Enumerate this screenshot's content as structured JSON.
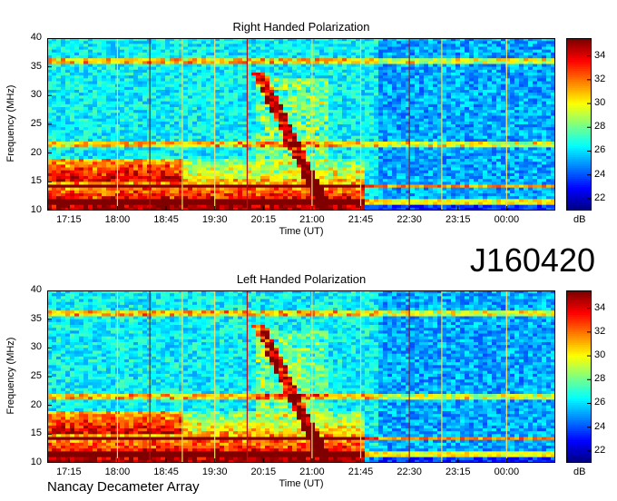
{
  "observatory": "Nancay Decameter Array",
  "code": "J160420",
  "chart_data": [
    {
      "type": "heatmap",
      "title": "Right Handed Polarization",
      "xlabel": "Time (UT)",
      "ylabel": "Frequency (MHz)",
      "x_ticks": [
        "17:15",
        "18:00",
        "18:45",
        "19:30",
        "20:15",
        "21:00",
        "21:45",
        "22:30",
        "23:15",
        "00:00"
      ],
      "y_ticks": [
        10,
        15,
        20,
        25,
        30,
        35,
        40
      ],
      "ylim": [
        10,
        40
      ],
      "xlim": [
        "16:55",
        "00:45"
      ],
      "colorbar": {
        "unit": "dB",
        "range": [
          21,
          35.5
        ],
        "ticks": [
          22,
          24,
          26,
          28,
          30,
          32,
          34
        ]
      },
      "vertical_markers": [
        "18:00",
        "18:30",
        "19:00",
        "19:30",
        "20:00",
        "21:00",
        "21:45",
        "22:30",
        "23:00",
        "00:00"
      ]
    },
    {
      "type": "heatmap",
      "title": "Left Handed Polarization",
      "xlabel": "Time (UT)",
      "ylabel": "Frequency (MHz)",
      "x_ticks": [
        "17:15",
        "18:00",
        "18:45",
        "19:30",
        "20:15",
        "21:00",
        "21:45",
        "22:30",
        "23:15",
        "00:00"
      ],
      "y_ticks": [
        10,
        15,
        20,
        25,
        30,
        35,
        40
      ],
      "ylim": [
        10,
        40
      ],
      "xlim": [
        "16:55",
        "00:45"
      ],
      "colorbar": {
        "unit": "dB",
        "range": [
          21,
          35.5
        ],
        "ticks": [
          22,
          24,
          26,
          28,
          30,
          32,
          34
        ]
      },
      "vertical_markers": [
        "18:00",
        "18:30",
        "19:00",
        "19:30",
        "20:00",
        "21:00",
        "21:45",
        "22:30",
        "23:00",
        "00:00"
      ]
    }
  ]
}
